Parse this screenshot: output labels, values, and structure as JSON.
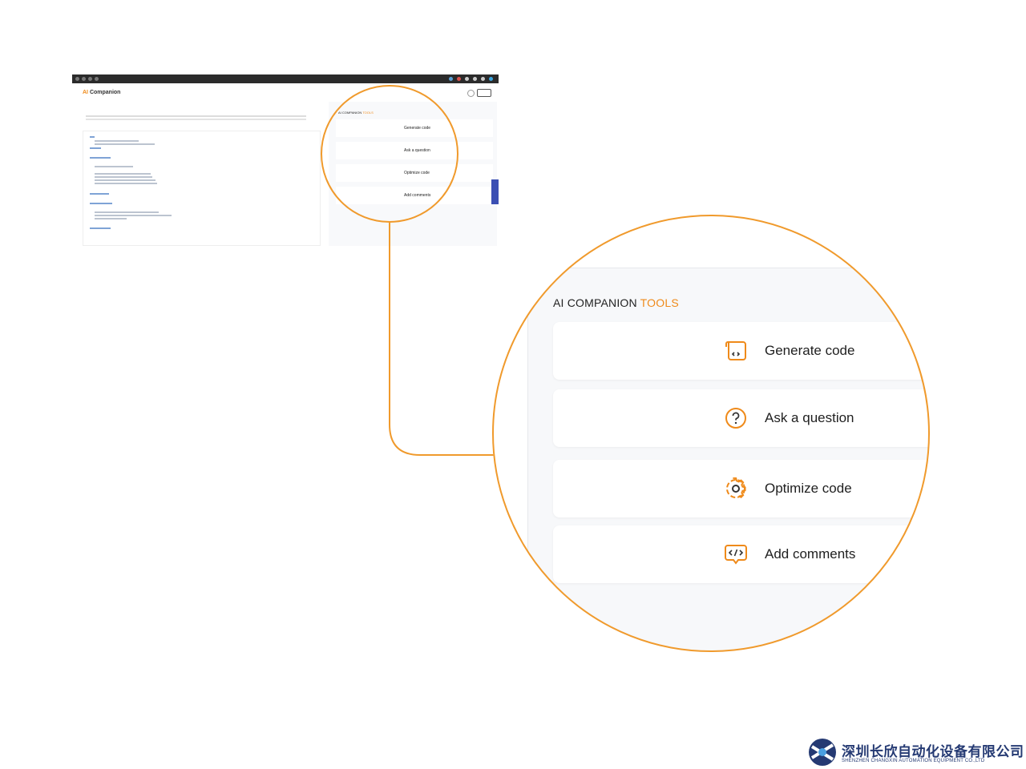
{
  "app": {
    "logo_ai": "AI",
    "logo_rest": " Companion"
  },
  "panel": {
    "label_prefix": "AI COMPANION ",
    "label_accent": "TOOLS"
  },
  "tools": [
    {
      "label": "Generate code",
      "icon": "code-bubble-icon"
    },
    {
      "label": "Ask a question",
      "icon": "question-circle-icon"
    },
    {
      "label": "Optimize code",
      "icon": "gear-icon"
    },
    {
      "label": "Add comments",
      "icon": "comment-code-icon"
    }
  ],
  "company": {
    "name_cn": "深圳长欣自动化设备有限公司",
    "name_en": "SHENZHEN CHANGXIN AUTOMATION EQUIPMENT CO.,LTD"
  },
  "colors": {
    "accent": "#ef8a1a",
    "brand": "#253a73"
  }
}
